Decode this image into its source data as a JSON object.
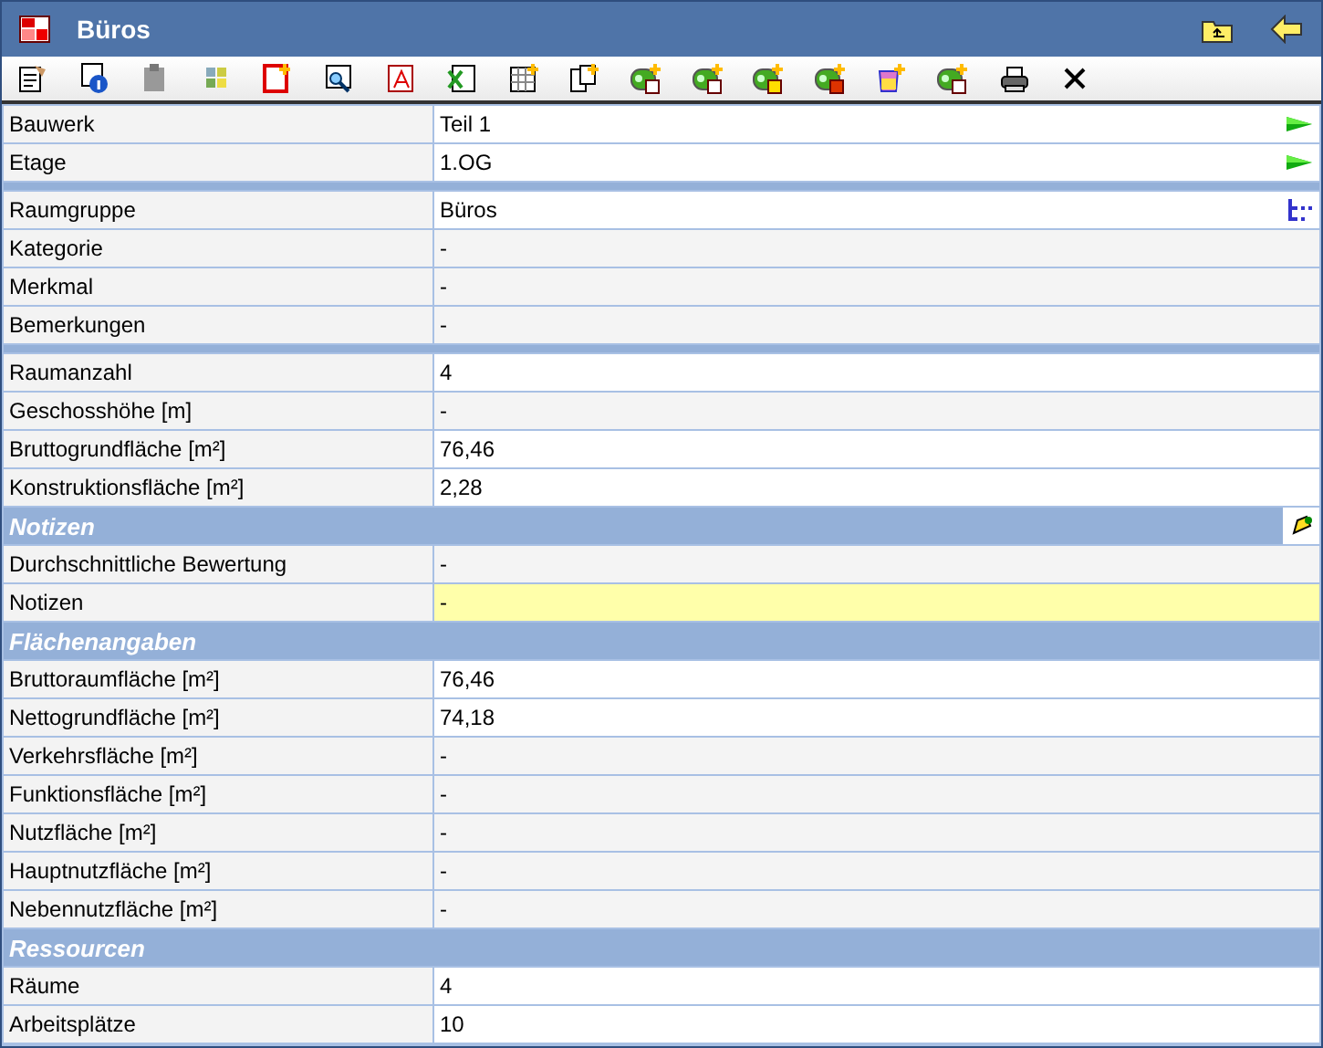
{
  "window": {
    "title": "Büros"
  },
  "sections": [
    {
      "rows": [
        {
          "label": "Bauwerk",
          "value": "Teil 1",
          "kind": "editable",
          "arrow_button": true
        },
        {
          "label": "Etage",
          "value": "1.OG",
          "kind": "editable",
          "arrow_button": true
        }
      ]
    },
    {
      "rows": [
        {
          "label": "Raumgruppe",
          "value": "Büros",
          "kind": "editable",
          "tree_button": true
        },
        {
          "label": "Kategorie",
          "value": "-",
          "kind": "readonly"
        },
        {
          "label": "Merkmal",
          "value": "-",
          "kind": "readonly"
        },
        {
          "label": "Bemerkungen",
          "value": "-",
          "kind": "readonly"
        }
      ]
    },
    {
      "rows": [
        {
          "label": "Raumanzahl",
          "value": "4",
          "kind": "editable"
        },
        {
          "label": "Geschosshöhe [m]",
          "value": "-",
          "kind": "readonly"
        },
        {
          "label": "Bruttogrundfläche [m²]",
          "value": "76,46",
          "kind": "editable"
        },
        {
          "label": "Konstruktionsfläche [m²]",
          "value": "2,28",
          "kind": "editable"
        }
      ]
    },
    {
      "title": "Notizen",
      "note_button": true,
      "rows": [
        {
          "label": "Durchschnittliche Bewertung",
          "value": "-",
          "kind": "readonly"
        },
        {
          "label": "Notizen",
          "value": "-",
          "kind": "highlight"
        }
      ]
    },
    {
      "title": "Flächenangaben",
      "rows": [
        {
          "label": "Bruttoraumfläche [m²]",
          "value": "76,46",
          "kind": "editable"
        },
        {
          "label": "Nettogrundfläche [m²]",
          "value": "74,18",
          "kind": "editable"
        },
        {
          "label": "Verkehrsfläche [m²]",
          "value": "-",
          "kind": "readonly"
        },
        {
          "label": "Funktionsfläche [m²]",
          "value": "-",
          "kind": "readonly"
        },
        {
          "label": "Nutzfläche [m²]",
          "value": "-",
          "kind": "readonly"
        },
        {
          "label": "Hauptnutzfläche [m²]",
          "value": "-",
          "kind": "readonly"
        },
        {
          "label": "Nebennutzfläche [m²]",
          "value": "-",
          "kind": "readonly"
        }
      ]
    },
    {
      "title": "Ressourcen",
      "rows": [
        {
          "label": "Räume",
          "value": "4",
          "kind": "editable"
        },
        {
          "label": "Arbeitsplätze",
          "value": "10",
          "kind": "editable"
        }
      ]
    }
  ]
}
